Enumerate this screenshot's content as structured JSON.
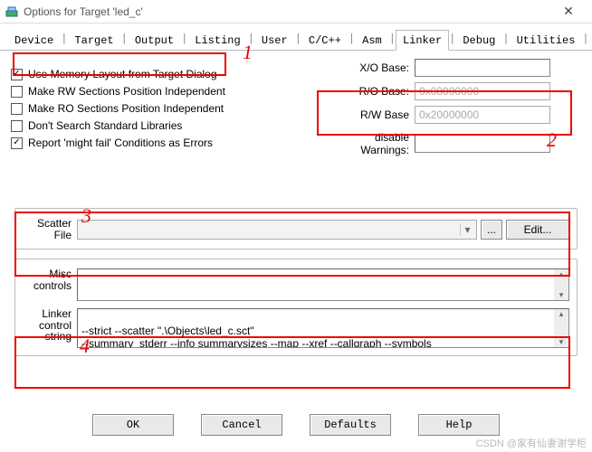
{
  "window": {
    "title": "Options for Target 'led_c'",
    "close_glyph": "✕"
  },
  "tabs": [
    "Device",
    "Target",
    "Output",
    "Listing",
    "User",
    "C/C++",
    "Asm",
    "Linker",
    "Debug",
    "Utilities"
  ],
  "active_tab": "Linker",
  "annot": {
    "n1": "1",
    "n2": "2",
    "n3": "3",
    "n4": "4"
  },
  "options": {
    "use_memory_layout": {
      "label": "Use Memory Layout from Target Dialog",
      "checked": true
    },
    "make_rw_pi": {
      "label": "Make RW Sections Position Independent",
      "checked": false
    },
    "make_ro_pi": {
      "label": "Make RO Sections Position Independent",
      "checked": false
    },
    "dont_search_std": {
      "label": "Don't Search Standard Libraries",
      "checked": false
    },
    "report_might_fail": {
      "label": "Report 'might fail' Conditions as Errors",
      "checked": true
    }
  },
  "bases": {
    "xo_label": "X/O Base:",
    "xo_value": "",
    "ro_label": "R/O Base:",
    "ro_value": "0x08000000",
    "rw_label": "R/W Base",
    "rw_value": "0x20000000",
    "disable_warn_label": "disable Warnings:",
    "disable_warn_value": ""
  },
  "scatter": {
    "label": "Scatter\nFile",
    "value": "",
    "browse_label": "...",
    "edit_label": "Edit..."
  },
  "misc": {
    "label": "Misc\ncontrols",
    "value": ""
  },
  "linker_ctrl": {
    "label": "Linker\ncontrol\nstring",
    "value": "--strict --scatter \".\\Objects\\led_c.sct\"\n--summary_stderr --info summarysizes --map --xref --callgraph --symbols"
  },
  "buttons": {
    "ok": "OK",
    "cancel": "Cancel",
    "defaults": "Defaults",
    "help": "Help"
  },
  "watermark": "CSDN @家有仙妻谢学柜"
}
